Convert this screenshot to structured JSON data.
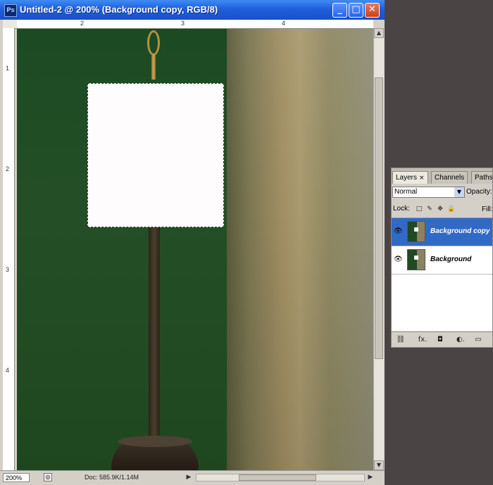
{
  "window": {
    "title": "Untitled-2 @ 200% (Background copy, RGB/8)",
    "app_icon_text": "Ps",
    "buttons": {
      "minimize": "_",
      "maximize": "□",
      "close": "✕"
    }
  },
  "rulers": {
    "top_labels": [
      "2",
      "3",
      "4"
    ],
    "left_labels": [
      "1",
      "2",
      "3",
      "4"
    ]
  },
  "statusbar": {
    "zoom": "200%",
    "doc_info": "Doc: 585.9K/1.14M",
    "left_arrow": "◀",
    "right_arrow": "▶"
  },
  "scrollbar": {
    "up": "▲",
    "down": "▼"
  },
  "layers_panel": {
    "tabs": [
      {
        "label": "Layers",
        "close": "×"
      },
      {
        "label": "Channels"
      },
      {
        "label": "Paths"
      }
    ],
    "blend_mode": "Normal",
    "blend_arrow": "▼",
    "opacity_label": "Opacity:",
    "lock_label": "Lock:",
    "lock_icons": [
      "□",
      "✎",
      "✥",
      "🔒"
    ],
    "fill_label": "Fill:",
    "layers": [
      {
        "name": "Background copy",
        "selected": true,
        "eye": "👁"
      },
      {
        "name": "Background",
        "selected": false,
        "eye": "👁"
      }
    ],
    "footer_icons": [
      "⛓",
      "fx.",
      "◘",
      "◐.",
      "▭"
    ]
  },
  "colors": {
    "titlebar": "#1f5fdd",
    "selection": "#316ac5",
    "wall_green": "#1f4a22",
    "wall_beige": "#a08f63"
  }
}
